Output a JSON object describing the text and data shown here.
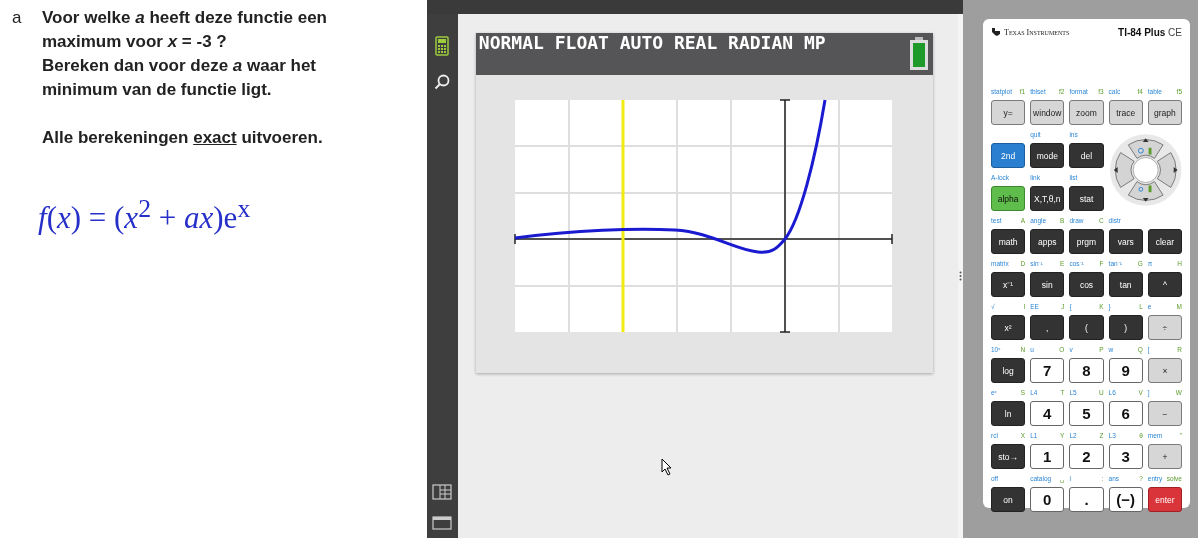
{
  "question": {
    "letter": "a",
    "lines": [
      "Voor welke *a* heeft deze functie een",
      "maximum voor *x* = -3 ?",
      "Bereken dan voor deze *a* waar het",
      "minimum van de functie ligt."
    ],
    "instruction": {
      "before": "Alle berekeningen ",
      "emphasis": "exact",
      "after": " uitvoeren."
    },
    "formula": "*f*(*x*) = (*x*$^{2}$ + *ax*)e$^{x}$"
  },
  "screen": {
    "status": "NORMAL FLOAT AUTO REAL RADIAN MP"
  },
  "calculator": {
    "brand": "Texas Instruments",
    "model": "TI-84 Plus",
    "model_suffix": "CE",
    "key_rows": [
      [
        {
          "label": "y=",
          "second": "statplot",
          "alpha": "f1",
          "kind": "light"
        },
        {
          "label": "window",
          "second": "tblset",
          "alpha": "f2",
          "kind": "light"
        },
        {
          "label": "zoom",
          "second": "format",
          "alpha": "f3",
          "kind": "light"
        },
        {
          "label": "trace",
          "second": "calc",
          "alpha": "f4",
          "kind": "light"
        },
        {
          "label": "graph",
          "second": "table",
          "alpha": "f5",
          "kind": "light"
        }
      ],
      [
        {
          "label": "2nd",
          "kind": "blue"
        },
        {
          "label": "mode",
          "second": "quit",
          "kind": "dark"
        },
        {
          "label": "del",
          "second": "ins",
          "kind": "dark"
        }
      ],
      [
        {
          "label": "alpha",
          "second": "A-lock",
          "kind": "green"
        },
        {
          "label": "X,T,θ,n",
          "second": "link",
          "kind": "dark"
        },
        {
          "label": "stat",
          "second": "list",
          "kind": "dark"
        }
      ],
      [
        {
          "label": "math",
          "second": "test",
          "alpha": "A",
          "kind": "dark"
        },
        {
          "label": "apps",
          "second": "angle",
          "alpha": "B",
          "kind": "dark"
        },
        {
          "label": "prgm",
          "second": "draw",
          "alpha": "C",
          "kind": "dark"
        },
        {
          "label": "vars",
          "second": "distr",
          "kind": "dark"
        },
        {
          "label": "clear",
          "kind": "dark"
        }
      ],
      [
        {
          "label": "x⁻¹",
          "second": "matrix",
          "alpha": "D",
          "kind": "dark"
        },
        {
          "label": "sin",
          "second": "sin⁻¹",
          "alpha": "E",
          "kind": "dark"
        },
        {
          "label": "cos",
          "second": "cos⁻¹",
          "alpha": "F",
          "kind": "dark"
        },
        {
          "label": "tan",
          "second": "tan⁻¹",
          "alpha": "G",
          "kind": "dark"
        },
        {
          "label": "^",
          "second": "π",
          "alpha": "H",
          "kind": "dark"
        }
      ],
      [
        {
          "label": "x²",
          "second": "√",
          "alpha": "I",
          "kind": "dark"
        },
        {
          "label": ",",
          "second": "EE",
          "alpha": "J",
          "kind": "dark"
        },
        {
          "label": "(",
          "second": "{",
          "alpha": "K",
          "kind": "dark"
        },
        {
          "label": ")",
          "second": "}",
          "alpha": "L",
          "kind": "dark"
        },
        {
          "label": "÷",
          "second": "e",
          "alpha": "M",
          "kind": "light"
        }
      ],
      [
        {
          "label": "log",
          "second": "10ˣ",
          "alpha": "N",
          "kind": "dark"
        },
        {
          "label": "7",
          "second": "u",
          "alpha": "O",
          "kind": "white"
        },
        {
          "label": "8",
          "second": "v",
          "alpha": "P",
          "kind": "white"
        },
        {
          "label": "9",
          "second": "w",
          "alpha": "Q",
          "kind": "white"
        },
        {
          "label": "×",
          "second": "[",
          "alpha": "R",
          "kind": "light"
        }
      ],
      [
        {
          "label": "ln",
          "second": "eˣ",
          "alpha": "S",
          "kind": "dark"
        },
        {
          "label": "4",
          "second": "L4",
          "alpha": "T",
          "kind": "white"
        },
        {
          "label": "5",
          "second": "L5",
          "alpha": "U",
          "kind": "white"
        },
        {
          "label": "6",
          "second": "L6",
          "alpha": "V",
          "kind": "white"
        },
        {
          "label": "−",
          "second": "]",
          "alpha": "W",
          "kind": "light"
        }
      ],
      [
        {
          "label": "sto→",
          "second": "rcl",
          "alpha": "X",
          "kind": "dark"
        },
        {
          "label": "1",
          "second": "L1",
          "alpha": "Y",
          "kind": "white"
        },
        {
          "label": "2",
          "second": "L2",
          "alpha": "Z",
          "kind": "white"
        },
        {
          "label": "3",
          "second": "L3",
          "alpha": "θ",
          "kind": "white"
        },
        {
          "label": "+",
          "second": "mem",
          "alpha": "\"",
          "kind": "light"
        }
      ],
      [
        {
          "label": "on",
          "second": "off",
          "kind": "dark"
        },
        {
          "label": "0",
          "second": "catalog",
          "alpha": "␣",
          "kind": "white"
        },
        {
          "label": ".",
          "second": "i",
          "alpha": ":",
          "kind": "white"
        },
        {
          "label": "(−)",
          "second": "ans",
          "alpha": "?",
          "kind": "white"
        },
        {
          "label": "enter",
          "second": "entry",
          "alpha": "solve",
          "kind": "red"
        }
      ]
    ]
  }
}
